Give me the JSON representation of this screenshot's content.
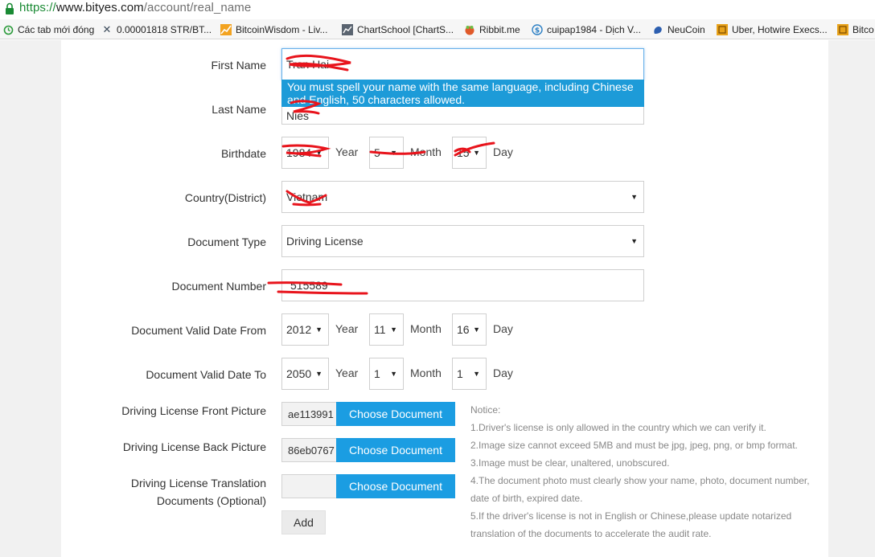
{
  "browser": {
    "url_scheme": "https://",
    "url_domain": "www.bityes.com",
    "url_path": "/account/real_name",
    "bookmarks": [
      {
        "icon": "restore-icon",
        "label": "Các tab mới đóng"
      },
      {
        "icon": "x-logo-icon",
        "label": "0.00001818 STR/BT..."
      },
      {
        "icon": "chart-icon",
        "label": "BitcoinWisdom - Liv..."
      },
      {
        "icon": "chartschool-icon",
        "label": "ChartSchool [ChartS..."
      },
      {
        "icon": "ribbit-icon",
        "label": "Ribbit.me"
      },
      {
        "icon": "dollar-circle-icon",
        "label": "cuipap1984 - Dịch V..."
      },
      {
        "icon": "squirrel-icon",
        "label": "NeuCoin"
      },
      {
        "icon": "coin-icon",
        "label": "Uber, Hotwire Execs..."
      },
      {
        "icon": "coin-icon",
        "label": "Bitco"
      }
    ]
  },
  "form": {
    "first_name": {
      "label": "First Name",
      "value": "Tran Hai"
    },
    "name_tooltip": "You must spell your name with the same language, including Chinese and English, 50 characters allowed.",
    "last_name": {
      "label": "Last Name",
      "value": "Nies"
    },
    "birthdate": {
      "label": "Birthdate",
      "year": "1984",
      "month": "5",
      "day": "15",
      "year_unit": "Year",
      "month_unit": "Month",
      "day_unit": "Day"
    },
    "country": {
      "label": "Country(District)",
      "value": "Vietnam"
    },
    "document_type": {
      "label": "Document Type",
      "value": "Driving License"
    },
    "document_number": {
      "label": "Document Number",
      "value": "515589"
    },
    "valid_from": {
      "label": "Document Valid Date From",
      "year": "2012",
      "month": "11",
      "day": "16",
      "year_unit": "Year",
      "month_unit": "Month",
      "day_unit": "Day"
    },
    "valid_to": {
      "label": "Document Valid Date To",
      "year": "2050",
      "month": "1",
      "day": "1",
      "year_unit": "Year",
      "month_unit": "Month",
      "day_unit": "Day"
    },
    "front_picture": {
      "label": "Driving License Front Picture",
      "file": "ae113991",
      "button": "Choose Document"
    },
    "back_picture": {
      "label": "Driving License Back Picture",
      "file": "86eb0767",
      "button": "Choose Document"
    },
    "translation": {
      "label_line1": "Driving License Translation",
      "label_line2": "Documents (Optional)",
      "file": "",
      "button": "Choose Document"
    },
    "add_button": "Add"
  },
  "notice": {
    "title": "Notice:",
    "lines": [
      "1.Driver's license is only allowed in the country which we can verify it.",
      "2.Image size cannot exceed 5MB and must be jpg, jpeg, png, or bmp format.",
      "3.Image must be clear, unaltered, unobscured.",
      "4.The document photo must clearly show your name, photo, document number,",
      "date of birth, expired date.",
      "5.If the driver's license is not in English or Chinese,please update notarized",
      "translation of the documents to accelerate the audit rate."
    ]
  },
  "colors": {
    "accent": "#1b9de2",
    "tooltip": "#1d9bd8",
    "redaction": "#e8141c",
    "url_green": "#1a8a34"
  }
}
